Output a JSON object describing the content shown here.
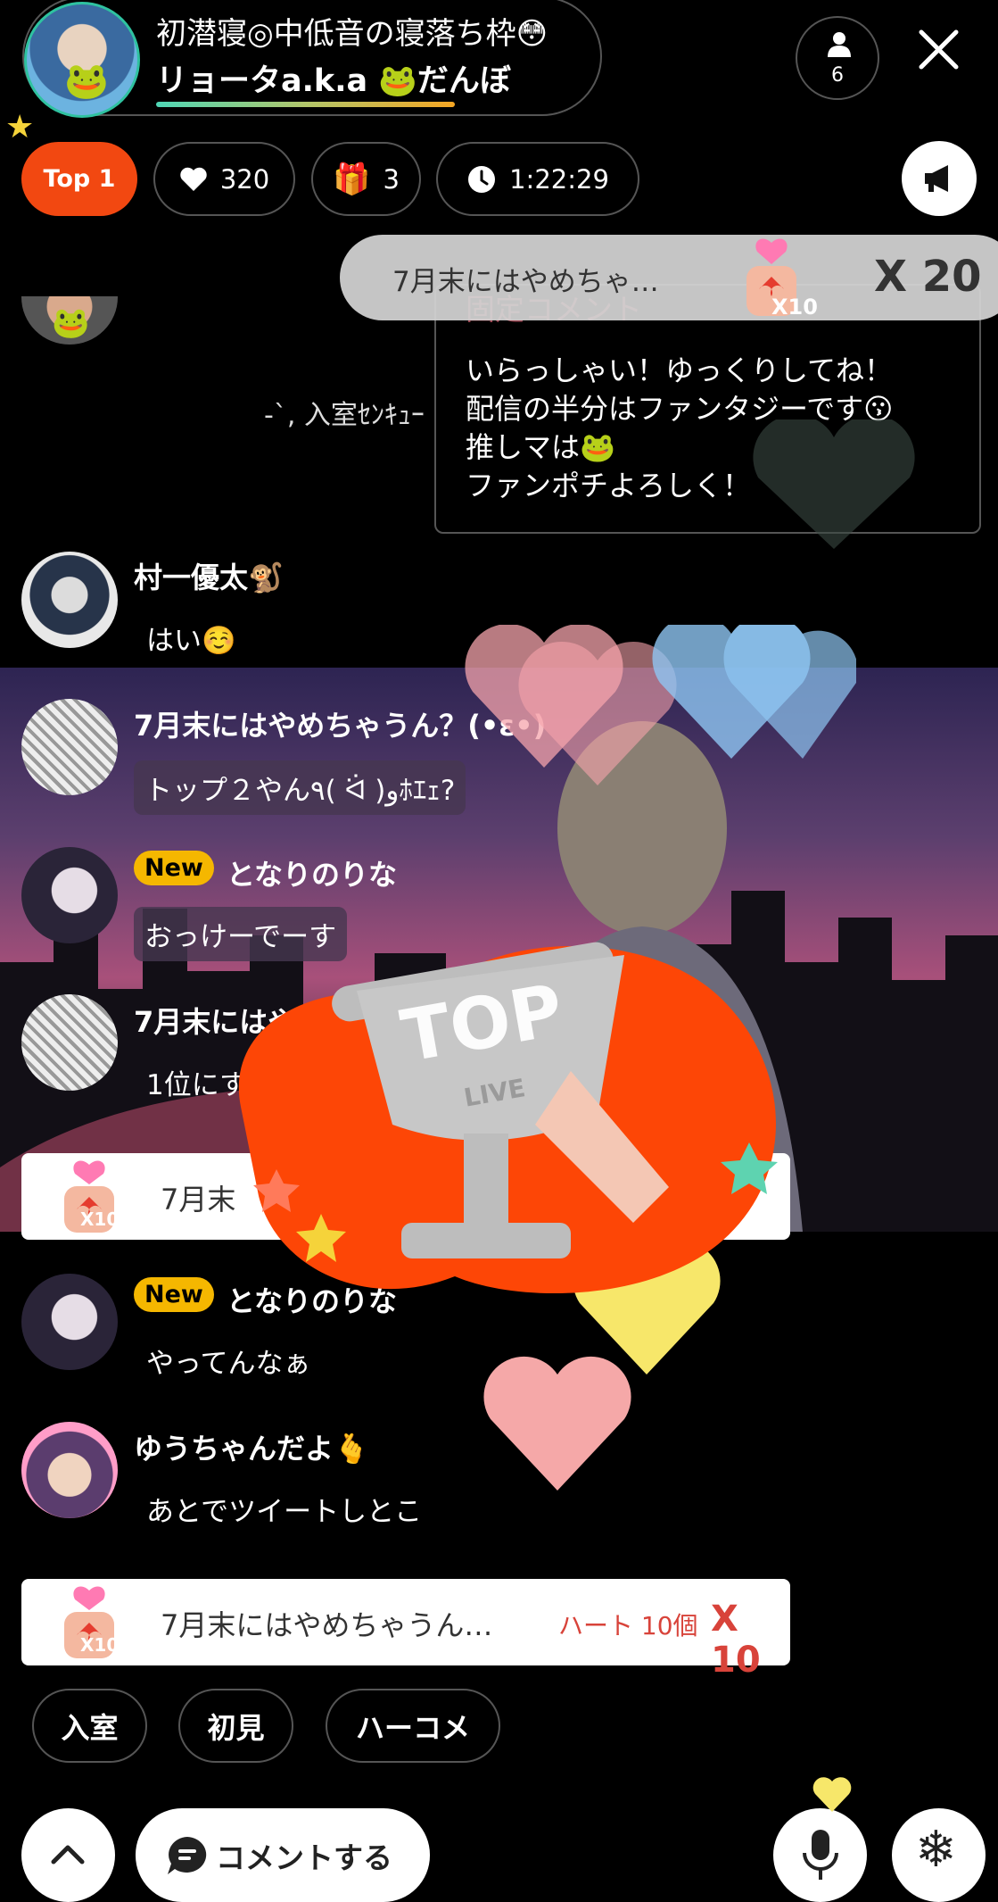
{
  "header": {
    "stream_title": "初潜寝◎中低音の寝落ち枠😳",
    "host_name": "リョータa.k.a 🐸だんぼ",
    "viewer_count": "6"
  },
  "stats": {
    "rank_label": "Top 1",
    "hearts": "320",
    "gifts": "3",
    "elapsed": "1:22:29"
  },
  "top_gift_banner": {
    "sender": "7月末にはやめちゃ…",
    "badge": "X10",
    "multiplier": "X 20"
  },
  "pinned_comment": {
    "label": "固定コメント",
    "lines": [
      "いらっしゃい！ゆっくりしてね！",
      "配信の半分はファンタジーです😗",
      "推しマは🐸",
      "ファンポチよろしく！"
    ]
  },
  "chat": {
    "entry_notice": "-`, 入室ｾﾝｷｭｰ",
    "messages": [
      {
        "user": "村一優太🐒",
        "text": "はい☺️"
      },
      {
        "user": "7月末にはやめちゃうん？(•ε•)",
        "text": "トップ２やん٩( ᐛ )وﾎｴｪ?"
      },
      {
        "user": "となりのりな",
        "badge": "New",
        "text": "おっけーでーす"
      },
      {
        "user": "7月末にはや",
        "text": "1位にす"
      },
      {
        "user": "となりのりな",
        "badge": "New",
        "text": "やってんなぁ"
      },
      {
        "user": "ゆうちゃんだよ🫰",
        "text": "あとでツイートしとこ"
      }
    ]
  },
  "gift_rows": [
    {
      "sender": "7月末",
      "badge": "X10",
      "count": "",
      "multiplier": ""
    },
    {
      "sender": "7月末にはやめちゃうん…",
      "badge": "X10",
      "count": "ハート 10個",
      "multiplier": "X 10"
    }
  ],
  "quick_replies": [
    "入室",
    "初見",
    "ハーコメ"
  ],
  "bottom_bar": {
    "comment_label": "コメントする"
  },
  "effect": {
    "trophy_top": "TOP",
    "trophy_live": "LIVE"
  },
  "colors": {
    "accent_orange": "#f24811",
    "new_badge": "#f5b700",
    "gift_red": "#d8433a"
  }
}
